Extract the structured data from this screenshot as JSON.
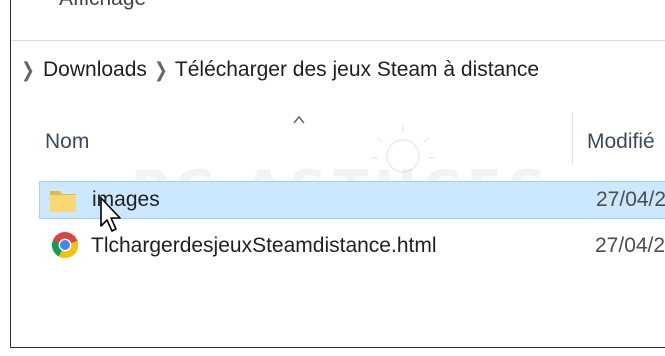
{
  "ribbon": {
    "tab_label": "Affichage"
  },
  "address": {
    "crumbs": [
      {
        "label": "Downloads"
      },
      {
        "label": "Télécharger des jeux Steam à distance"
      }
    ]
  },
  "columns": {
    "name": "Nom",
    "modified": "Modifié"
  },
  "watermark": {
    "text": "PC ASTUCES"
  },
  "files": [
    {
      "name": "images",
      "date": "27/04/2",
      "icon": "folder-icon",
      "selected": true
    },
    {
      "name": "TlchargerdesjeuxSteamdistance.html",
      "date": "27/04/2",
      "icon": "chrome-icon",
      "selected": false
    }
  ],
  "colors": {
    "selection_bg": "#cce8ff",
    "selection_border": "#99d1ff",
    "folder": "#f8d775"
  }
}
